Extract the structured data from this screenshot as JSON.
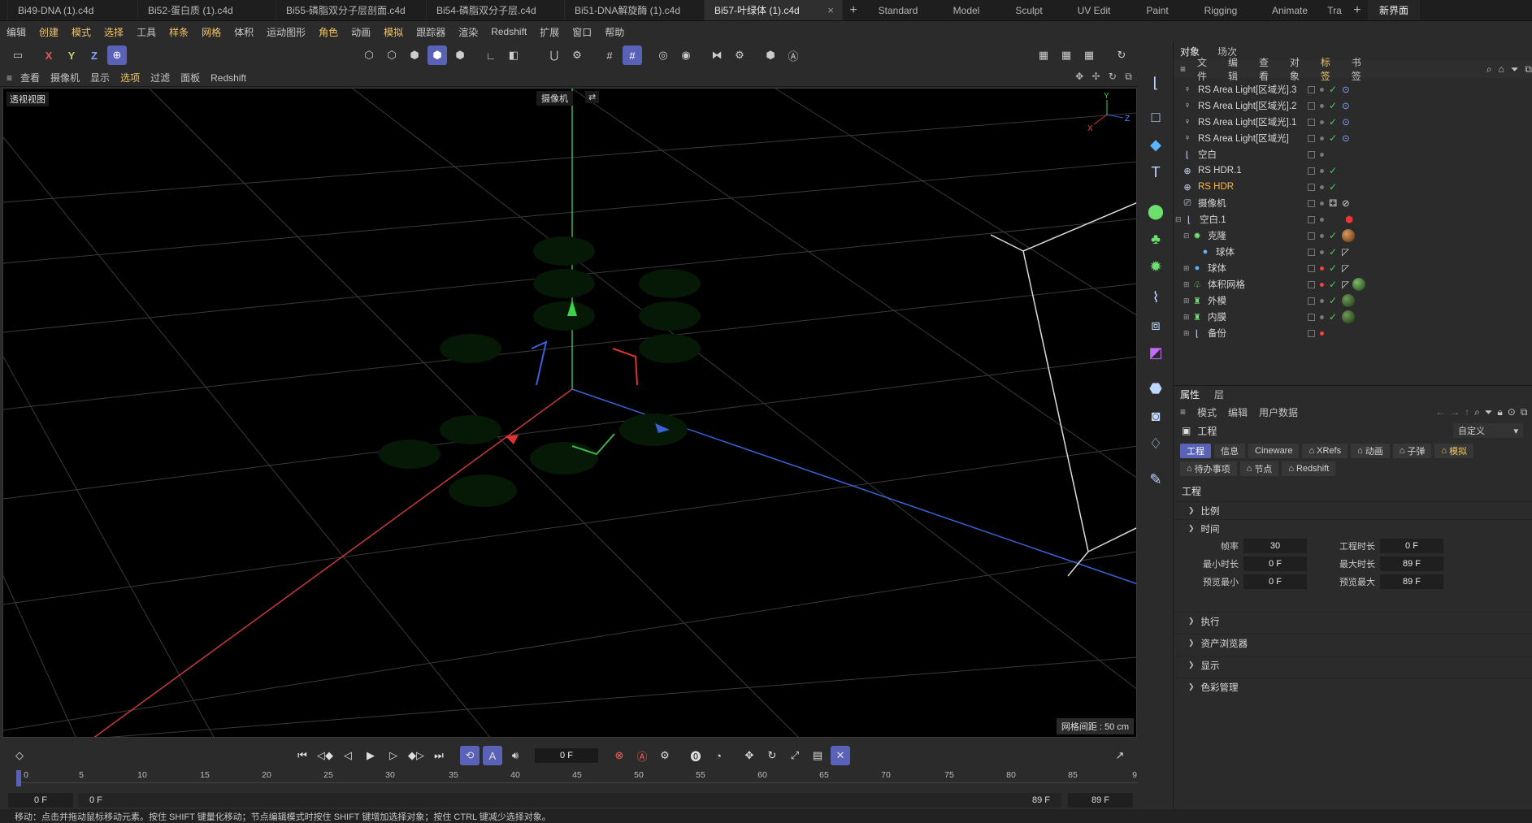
{
  "tabs": [
    {
      "label": "Bi49-DNA (1).c4d",
      "active": false
    },
    {
      "label": "Bi52-蛋白质 (1).c4d",
      "active": false
    },
    {
      "label": "Bi55-磷脂双分子层剖面.c4d",
      "active": false
    },
    {
      "label": "Bi54-磷脂双分子层.c4d",
      "active": false
    },
    {
      "label": "Bi51-DNA解旋酶 (1).c4d",
      "active": false
    },
    {
      "label": "Bi57-叶绿体 (1).c4d",
      "active": true
    }
  ],
  "layouts": [
    "Standard",
    "Model",
    "Sculpt",
    "UV Edit",
    "Paint",
    "Rigging",
    "Animate",
    "Tra"
  ],
  "new_ui": "新界面",
  "menu": [
    "编辑",
    "创建",
    "模式",
    "选择",
    "工具",
    "样条",
    "网格",
    "体积",
    "运动图形",
    "角色",
    "动画",
    "模拟",
    "跟踪器",
    "渲染",
    "Redshift",
    "扩展",
    "窗口",
    "帮助"
  ],
  "viewport_menu": [
    "查看",
    "摄像机",
    "显示",
    "选项",
    "过滤",
    "面板",
    "Redshift"
  ],
  "viewport": {
    "label": "透视视图",
    "camera": "摄像机",
    "grid_spacing": "网格间距 : 50 cm"
  },
  "panel_tabs": [
    "对象",
    "场次"
  ],
  "object_menu": [
    "文件",
    "编辑",
    "查看",
    "对象",
    "标签",
    "书签"
  ],
  "objects": [
    {
      "name": "RS Area Light[区域光].3",
      "icon": "light-icon"
    },
    {
      "name": "RS Area Light[区域光].2",
      "icon": "light-icon"
    },
    {
      "name": "RS Area Light[区域光].1",
      "icon": "light-icon"
    },
    {
      "name": "RS Area Light[区域光]",
      "icon": "light-icon"
    },
    {
      "name": "空白",
      "icon": "null-icon"
    },
    {
      "name": "RS HDR.1",
      "icon": "globe-icon"
    },
    {
      "name": "RS HDR",
      "icon": "globe-icon",
      "highlight": true
    },
    {
      "name": "摄像机",
      "icon": "camera-icon"
    },
    {
      "name": "空白.1",
      "icon": "null-icon"
    },
    {
      "name": "克隆",
      "icon": "cloner-icon"
    },
    {
      "name": "球体",
      "icon": "sphere-icon"
    },
    {
      "name": "球体",
      "icon": "sphere-icon"
    },
    {
      "name": "体积网格",
      "icon": "volume-icon"
    },
    {
      "name": "外模",
      "icon": "shirt-icon"
    },
    {
      "name": "内膜",
      "icon": "shirt-icon"
    },
    {
      "name": "备份",
      "icon": "null-icon"
    }
  ],
  "attr_tabs": [
    "属性",
    "层"
  ],
  "attr_menu": [
    "模式",
    "编辑",
    "用户数据"
  ],
  "attr_object": "工程",
  "attr_preset": "自定义",
  "attr_buttons": [
    "工程",
    "信息",
    "Cineware",
    "XRefs",
    "动画",
    "子弹",
    "模拟",
    "待办事项",
    "节点",
    "Redshift"
  ],
  "attr_section": "工程",
  "sections": {
    "scale": "比例",
    "time": "时间",
    "execute": "执行",
    "asset": "资产浏览器",
    "display": "显示",
    "color": "色彩管理"
  },
  "time_fields": {
    "fps_label": "帧率",
    "fps": "30",
    "proj_len_label": "工程时长",
    "proj_len": "0 F",
    "min_label": "最小时长",
    "min": "0 F",
    "max_label": "最大时长",
    "max": "89 F",
    "pmin_label": "预览最小",
    "pmin": "0 F",
    "pmax_label": "预览最大",
    "pmax": "89 F"
  },
  "timeline": {
    "current_frame": "0 F",
    "ticks": [
      "0",
      "5",
      "10",
      "15",
      "20",
      "25",
      "30",
      "35",
      "40",
      "45",
      "50",
      "55",
      "60",
      "65",
      "70",
      "75",
      "80",
      "85",
      "9"
    ],
    "start": "0 F",
    "start2": "0 F",
    "end": "89 F",
    "end2": "89 F"
  },
  "status": "移动：点击并拖动鼠标移动元素。按住 SHIFT 键量化移动；节点编辑模式时按住 SHIFT 键增加选择对象；按住 CTRL 键减少选择对象。"
}
